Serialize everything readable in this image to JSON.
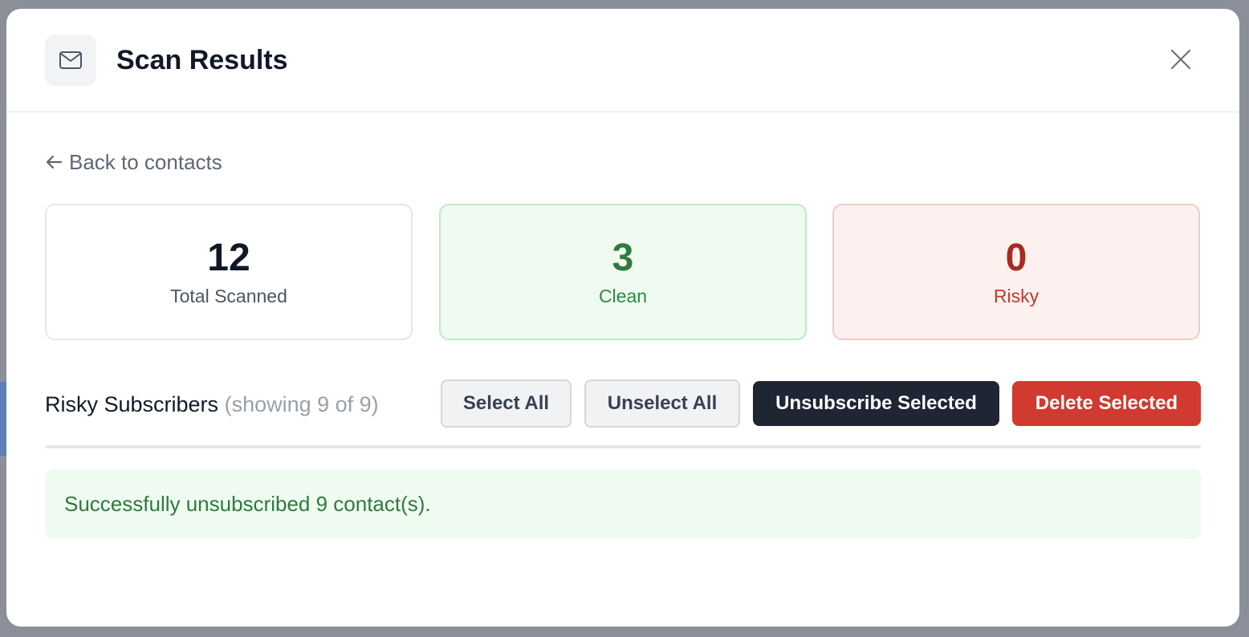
{
  "modal": {
    "title": "Scan Results",
    "header_icon": "mail-icon",
    "close_icon": "close-icon"
  },
  "back_link": {
    "icon": "arrow-left-icon",
    "label": "Back to contacts"
  },
  "stats": {
    "total": {
      "value": "12",
      "label": "Total Scanned"
    },
    "clean": {
      "value": "3",
      "label": "Clean",
      "color": "#2f7a3c"
    },
    "risky": {
      "value": "0",
      "label": "Risky",
      "color": "#a82a21"
    }
  },
  "risky_section": {
    "title": "Risky Subscribers",
    "count_text": "(showing 9 of 9)",
    "buttons": {
      "select_all": "Select All",
      "unselect_all": "Unselect All",
      "unsubscribe_selected": "Unsubscribe Selected",
      "delete_selected": "Delete Selected"
    }
  },
  "status_message": "Successfully unsubscribed 9 contact(s).",
  "colors": {
    "primary_dark": "#1f2533",
    "danger": "#d13a30",
    "success_bg": "#effbf1"
  }
}
